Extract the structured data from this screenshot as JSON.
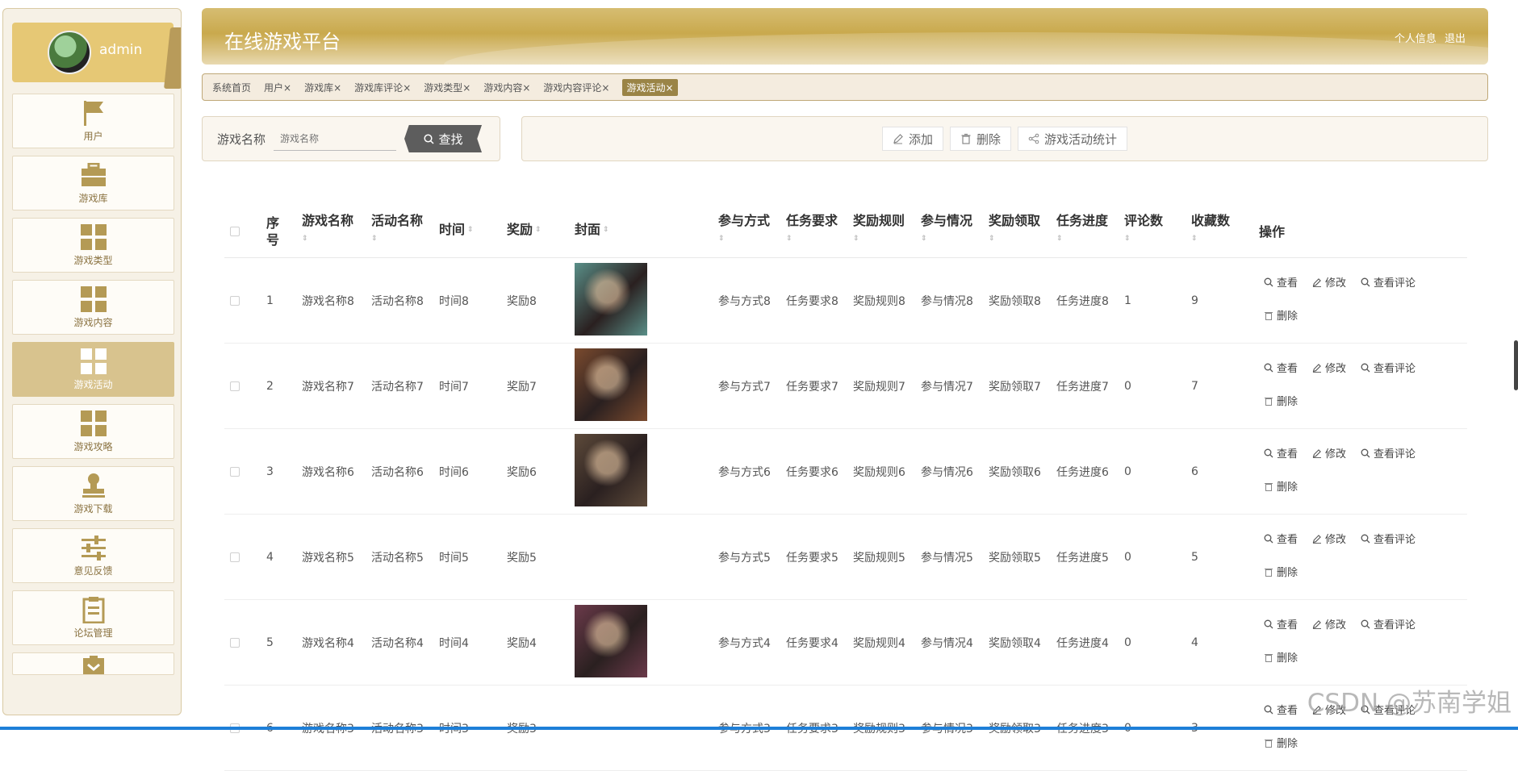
{
  "user": {
    "name": "admin"
  },
  "sidebar": {
    "items": [
      {
        "label": "用户",
        "icon": "flag-icon",
        "active": false
      },
      {
        "label": "游戏库",
        "icon": "briefcase-icon",
        "active": false
      },
      {
        "label": "游戏类型",
        "icon": "grid-icon",
        "active": false
      },
      {
        "label": "游戏内容",
        "icon": "grid-icon",
        "active": false
      },
      {
        "label": "游戏活动",
        "icon": "grid-icon",
        "active": true
      },
      {
        "label": "游戏攻略",
        "icon": "grid-icon",
        "active": false
      },
      {
        "label": "游戏下载",
        "icon": "stamp-icon",
        "active": false
      },
      {
        "label": "意见反馈",
        "icon": "sliders-icon",
        "active": false
      },
      {
        "label": "论坛管理",
        "icon": "clipboard-icon",
        "active": false
      }
    ]
  },
  "header": {
    "title": "在线游戏平台",
    "profile_link": "个人信息",
    "logout_link": "退出"
  },
  "tabs": [
    {
      "label": "系统首页",
      "closable": false,
      "active": false
    },
    {
      "label": "用户",
      "closable": true,
      "active": false
    },
    {
      "label": "游戏库",
      "closable": true,
      "active": false
    },
    {
      "label": "游戏库评论",
      "closable": true,
      "active": false
    },
    {
      "label": "游戏类型",
      "closable": true,
      "active": false
    },
    {
      "label": "游戏内容",
      "closable": true,
      "active": false
    },
    {
      "label": "游戏内容评论",
      "closable": true,
      "active": false
    },
    {
      "label": "游戏活动",
      "closable": true,
      "active": true
    }
  ],
  "search": {
    "label": "游戏名称",
    "placeholder": "游戏名称",
    "button": "查找"
  },
  "actions": {
    "add": "添加",
    "delete": "删除",
    "stats": "游戏活动统计"
  },
  "table": {
    "headers": {
      "index": "序号",
      "game_name": "游戏名称",
      "activity_name": "活动名称",
      "time": "时间",
      "reward": "奖励",
      "cover": "封面",
      "participation": "参与方式",
      "task_req": "任务要求",
      "reward_rule": "奖励规则",
      "participation_status": "参与情况",
      "reward_claim": "奖励领取",
      "task_progress": "任务进度",
      "comments": "评论数",
      "favorites": "收藏数",
      "ops": "操作"
    },
    "op_labels": {
      "view": "查看",
      "edit": "修改",
      "view_comments": "查看评论",
      "delete": "删除"
    },
    "rows": [
      {
        "index": "1",
        "game_name": "游戏名称8",
        "activity_name": "活动名称8",
        "time": "时间8",
        "reward": "奖励8",
        "participation": "参与方式8",
        "task_req": "任务要求8",
        "reward_rule": "奖励规则8",
        "participation_status": "参与情况8",
        "reward_claim": "奖励领取8",
        "task_progress": "任务进度8",
        "comments": "1",
        "favorites": "9",
        "cover_color": "#5a8f88"
      },
      {
        "index": "2",
        "game_name": "游戏名称7",
        "activity_name": "活动名称7",
        "time": "时间7",
        "reward": "奖励7",
        "participation": "参与方式7",
        "task_req": "任务要求7",
        "reward_rule": "奖励规则7",
        "participation_status": "参与情况7",
        "reward_claim": "奖励领取7",
        "task_progress": "任务进度7",
        "comments": "0",
        "favorites": "7",
        "cover_color": "#7a4a2e"
      },
      {
        "index": "3",
        "game_name": "游戏名称6",
        "activity_name": "活动名称6",
        "time": "时间6",
        "reward": "奖励6",
        "participation": "参与方式6",
        "task_req": "任务要求6",
        "reward_rule": "奖励规则6",
        "participation_status": "参与情况6",
        "reward_claim": "奖励领取6",
        "task_progress": "任务进度6",
        "comments": "0",
        "favorites": "6",
        "cover_color": "#5d4a3a"
      },
      {
        "index": "4",
        "game_name": "游戏名称5",
        "activity_name": "活动名称5",
        "time": "时间5",
        "reward": "奖励5",
        "participation": "参与方式5",
        "task_req": "任务要求5",
        "reward_rule": "奖励规则5",
        "participation_status": "参与情况5",
        "reward_claim": "奖励领取5",
        "task_progress": "任务进度5",
        "comments": "0",
        "favorites": "5",
        "cover_color": ""
      },
      {
        "index": "5",
        "game_name": "游戏名称4",
        "activity_name": "活动名称4",
        "time": "时间4",
        "reward": "奖励4",
        "participation": "参与方式4",
        "task_req": "任务要求4",
        "reward_rule": "奖励规则4",
        "participation_status": "参与情况4",
        "reward_claim": "奖励领取4",
        "task_progress": "任务进度4",
        "comments": "0",
        "favorites": "4",
        "cover_color": "#6b3a4a"
      },
      {
        "index": "6",
        "game_name": "游戏名称3",
        "activity_name": "活动名称3",
        "time": "时间3",
        "reward": "奖励3",
        "participation": "参与方式3",
        "task_req": "任务要求3",
        "reward_rule": "奖励规则3",
        "participation_status": "参与情况3",
        "reward_claim": "奖励领取3",
        "task_progress": "任务进度3",
        "comments": "0",
        "favorites": "3",
        "cover_color": ""
      }
    ]
  },
  "watermark": "CSDN @苏南学姐",
  "colors": {
    "accent": "#c9a94d",
    "active_menu": "#d8c38e",
    "active_tab": "#9a8446"
  }
}
